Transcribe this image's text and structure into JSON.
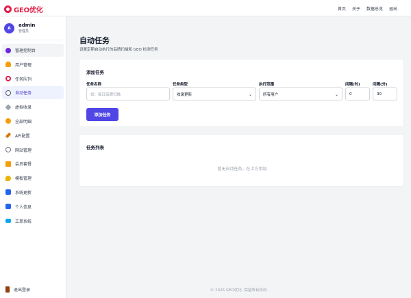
{
  "app": {
    "logo_text": "GEO优化"
  },
  "topnav": {
    "home": "首页",
    "about": "关于",
    "data_dashboard": "数据总览",
    "logout": "退出"
  },
  "user": {
    "avatar_letter": "A",
    "name": "admin",
    "role": "管理员"
  },
  "sidebar": {
    "items": [
      {
        "label": "管理控制台",
        "icon": "dashboard-icon",
        "color": "#6d28d9"
      },
      {
        "label": "用户管理",
        "icon": "users-icon",
        "color": "#f59e0b"
      },
      {
        "label": "任务队列",
        "icon": "queue-icon",
        "color": "#e11d48"
      },
      {
        "label": "自动任务",
        "icon": "clock-icon",
        "color": "#4b5563"
      },
      {
        "label": "虚拟收录",
        "icon": "link-icon",
        "color": "#6b7280"
      },
      {
        "label": "全部明细",
        "icon": "medal-icon",
        "color": "#f59e0b"
      },
      {
        "label": "API配置",
        "icon": "key-icon",
        "color": "#d97706"
      },
      {
        "label": "网站管理",
        "icon": "globe-icon",
        "color": "#6b7280"
      },
      {
        "label": "会员套餐",
        "icon": "crown-icon",
        "color": "#f59e0b"
      },
      {
        "label": "模板管理",
        "icon": "palette-icon",
        "color": "#eab308"
      },
      {
        "label": "系统更新",
        "icon": "update-icon",
        "color": "#2563eb"
      },
      {
        "label": "个人信息",
        "icon": "profile-icon",
        "color": "#2563eb"
      },
      {
        "label": "工单系统",
        "icon": "ticket-icon",
        "color": "#0ea5e9"
      }
    ],
    "logout_label": "退出登录"
  },
  "page": {
    "title": "自动任务",
    "subtitle": "设置定期自动执行的品牌扫描和 GEO 检测任务"
  },
  "add_task": {
    "title": "添加任务",
    "name_label": "任务名称",
    "name_placeholder": "如：每日品牌扫描",
    "type_label": "任务类型",
    "type_value": "收录更新",
    "scope_label": "执行范围",
    "scope_value": "所有用户",
    "interval_hours_label": "间隔(时)",
    "interval_hours_value": "0",
    "interval_minutes_label": "间隔(分)",
    "interval_minutes_value": "30",
    "button_label": "添加任务"
  },
  "task_list": {
    "title": "任务列表",
    "empty_text": "暂无自动任务，在上方添加"
  },
  "footer": {
    "text": "© 2026 GEO优化. 保留所有权利."
  },
  "colors": {
    "accent": "#4f46e5",
    "brand": "#e11d48"
  }
}
